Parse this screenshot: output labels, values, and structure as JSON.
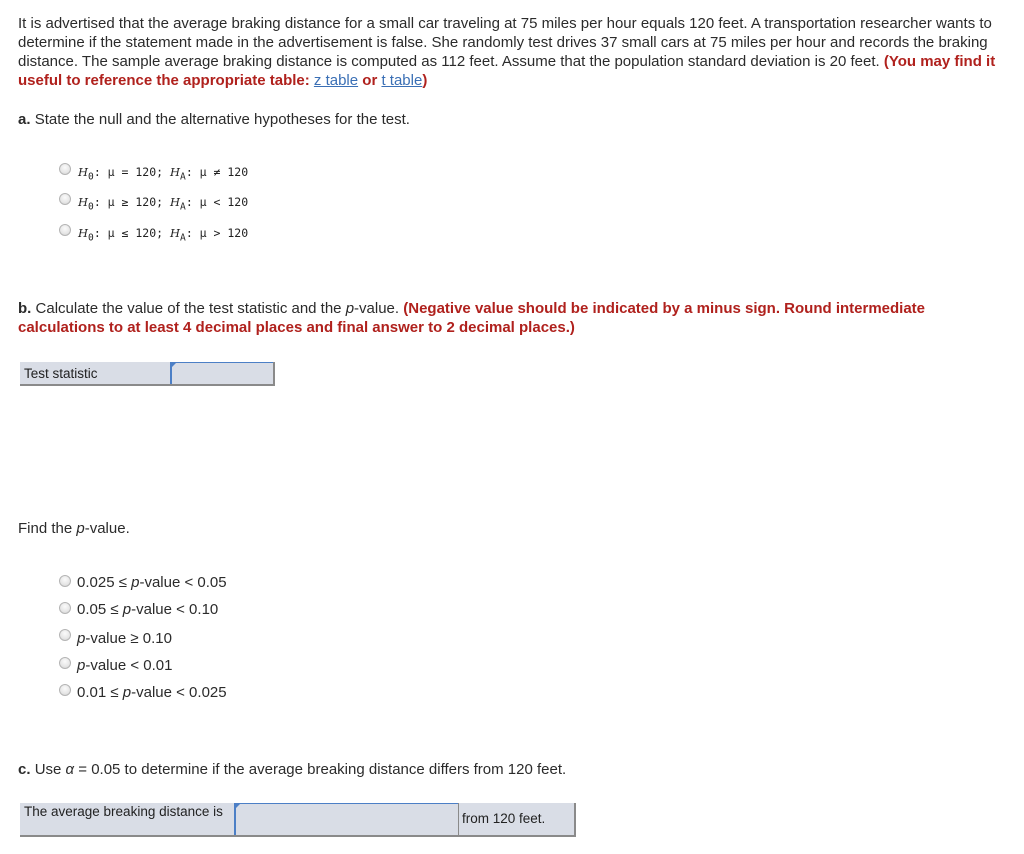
{
  "intro": {
    "text": "It is advertised that the average braking distance for a small car traveling at 75 miles per hour equals 120 feet. A transportation researcher wants to determine if the statement made in the advertisement is false. She randomly test drives 37 small cars at 75 miles per hour and records the braking distance. The sample average braking distance is computed as 112 feet. Assume that the population standard deviation is 20 feet.",
    "note_prefix": "(You may find it useful to reference the appropriate table:",
    "z_table_link": "z table",
    "or": "or",
    "t_table_link": "t table",
    "note_suffix": ")"
  },
  "part_a": {
    "label": "a.",
    "question": "State the null and the alternative hypotheses for the test.",
    "options": [
      {
        "h0": "H",
        "h0sub": "0",
        "h0rel": ": μ = 120;",
        "ha": "H",
        "hasub": "A",
        "harel": ": μ ≠ 120"
      },
      {
        "h0": "H",
        "h0sub": "0",
        "h0rel": ": μ ≥ 120;",
        "ha": "H",
        "hasub": "A",
        "harel": ": μ < 120"
      },
      {
        "h0": "H",
        "h0sub": "0",
        "h0rel": ": μ ≤ 120;",
        "ha": "H",
        "hasub": "A",
        "harel": ": μ > 120"
      }
    ]
  },
  "part_b": {
    "label": "b.",
    "question_pre": "Calculate the value of the test statistic and the ",
    "question_p": "p",
    "question_post": "-value.",
    "instruction": "(Negative value should be indicated by a minus sign. Round intermediate calculations to at least 4 decimal places and final answer to 2 decimal places.)",
    "test_statistic_label": "Test statistic",
    "test_statistic_value": "",
    "find_pre": "Find the ",
    "find_p": "p",
    "find_post": "-value.",
    "pvalue_options": [
      {
        "pre": "0.025 ≤ ",
        "p": "p",
        "post": "-value < 0.05"
      },
      {
        "pre": "0.05 ≤ ",
        "p": "p",
        "post": "-value < 0.10"
      },
      {
        "pre": "",
        "p": "p",
        "post": "-value ≥ 0.10"
      },
      {
        "pre": "",
        "p": "p",
        "post": "-value < 0.01"
      },
      {
        "pre": "0.01 ≤ ",
        "p": "p",
        "post": "-value < 0.025"
      }
    ]
  },
  "part_c": {
    "label": "c.",
    "question_pre": "Use ",
    "alpha": "α",
    "question_post": " = 0.05 to determine if the average breaking distance differs from 120 feet.",
    "row_label": "The average breaking distance is",
    "select_value": "",
    "row_suffix": "from 120 feet."
  },
  "colors": {
    "instruction_red": "#b0211d",
    "link_blue": "#3a6fb5",
    "input_bg": "#d9dde6",
    "input_border": "#4c7fc6"
  }
}
